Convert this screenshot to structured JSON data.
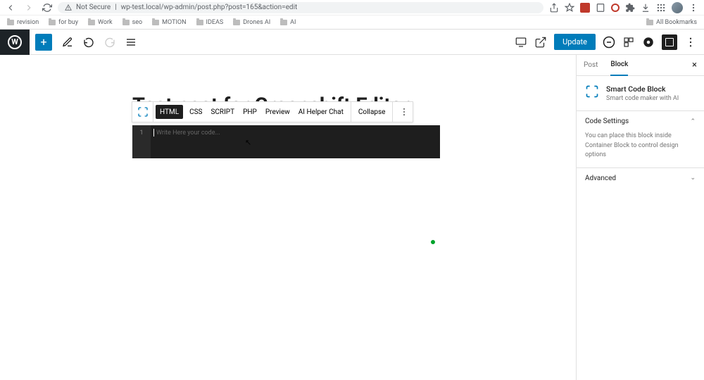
{
  "browser": {
    "security": "Not Secure",
    "url": "wp-test.local/wp-admin/post.php?post=165&action=edit"
  },
  "bookmarks": [
    "revision",
    "for buy",
    "Work",
    "seo",
    "MOTION",
    "IDEAS",
    "Drones AI",
    "AI"
  ],
  "bookmarks_right": "All Bookmarks",
  "toolbar": {
    "update": "Update"
  },
  "post": {
    "title": "Test post for Greenshift Editor"
  },
  "block_toolbar": {
    "tabs": [
      "HTML",
      "CSS",
      "SCRIPT",
      "PHP",
      "Preview",
      "AI Helper Chat"
    ],
    "collapse": "Collapse"
  },
  "code_editor": {
    "line": "1",
    "placeholder": "Write Here your code..."
  },
  "sidebar": {
    "tabs": {
      "post": "Post",
      "block": "Block"
    },
    "block": {
      "title": "Smart Code Block",
      "desc": "Smart code maker with AI"
    },
    "sections": {
      "code_settings": {
        "label": "Code Settings",
        "body": "You can place this block inside Container Block to control design options"
      },
      "advanced": {
        "label": "Advanced"
      }
    }
  }
}
